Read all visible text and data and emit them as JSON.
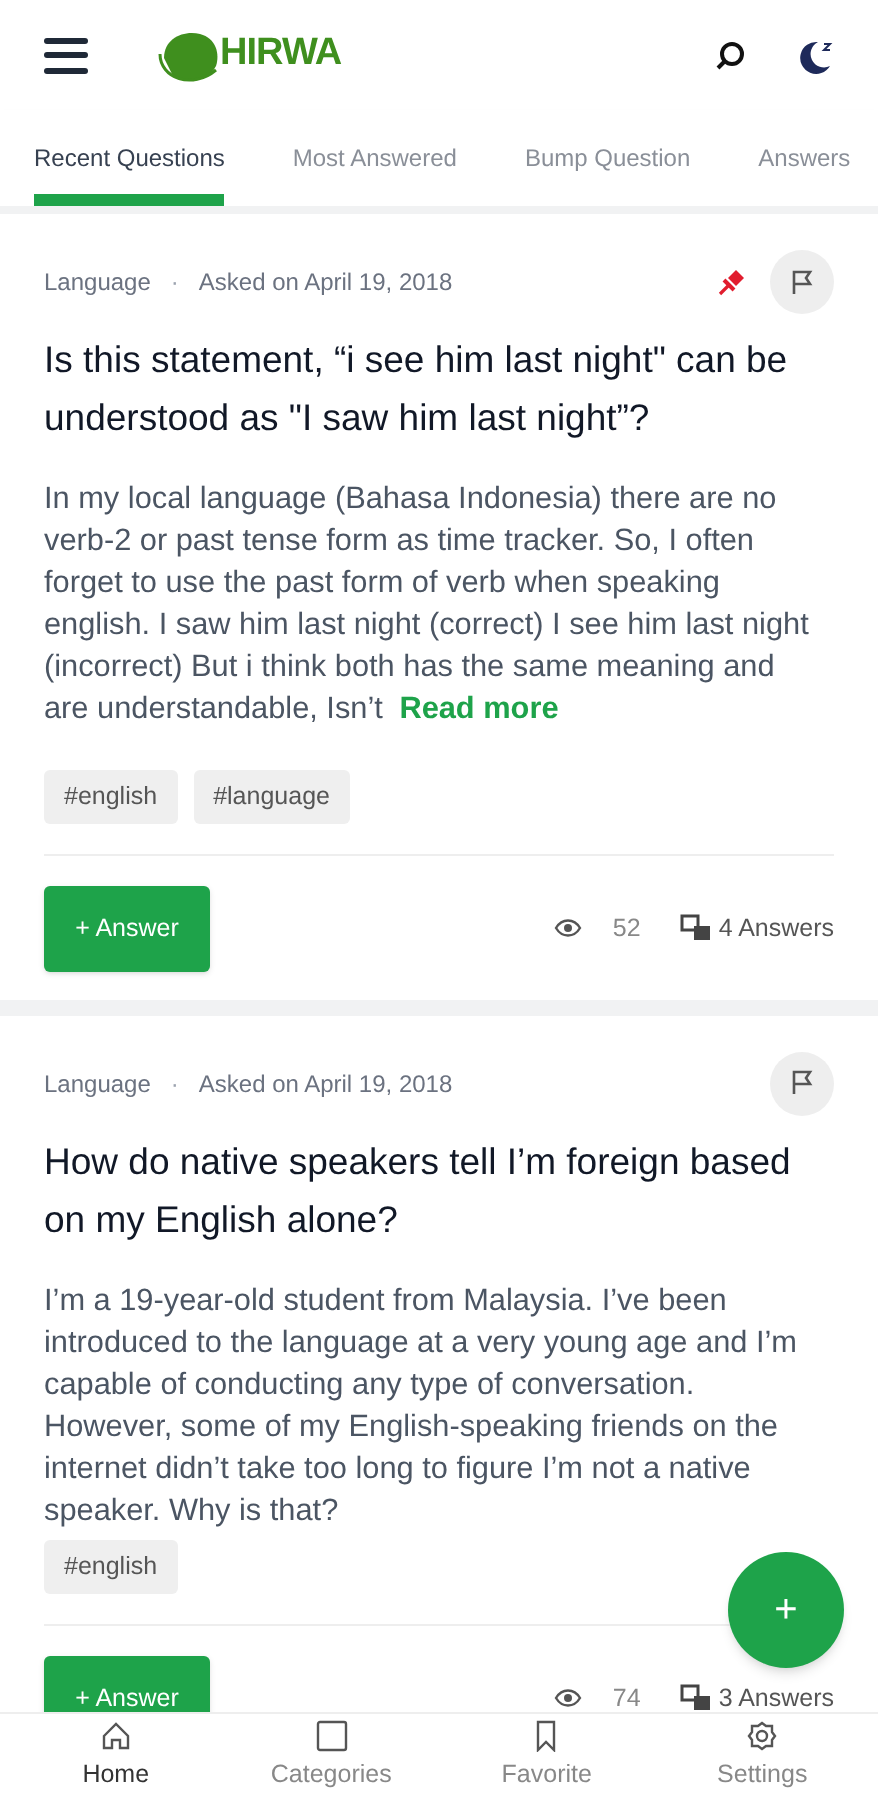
{
  "header": {
    "logo_text": "HIRWA"
  },
  "tabs": [
    {
      "label": "Recent Questions",
      "selected": true
    },
    {
      "label": "Most Answered",
      "selected": false
    },
    {
      "label": "Bump Question",
      "selected": false
    },
    {
      "label": "Answers",
      "selected": false
    }
  ],
  "questions": [
    {
      "category": "Language",
      "separator": "·",
      "asked": "Asked on April 19, 2018",
      "pinned": true,
      "title": "Is this statement, “i see him last night\" can be understood as \"I saw him last night”?",
      "body": "In my local language (Bahasa Indonesia) there are no verb-2 or past tense form as time tracker. So, I often forget to use the past form of verb when speaking english. I saw him last night (correct) I see him last night (incorrect) But i think both has the same meaning and are understandable, Isn’t",
      "read_more": "Read more",
      "tags": [
        "#english",
        "#language"
      ],
      "answer_button": "+ Answer",
      "views": "52",
      "answers": "4 Answers"
    },
    {
      "category": "Language",
      "separator": "·",
      "asked": "Asked on April 19, 2018",
      "pinned": false,
      "title": "How do native speakers tell I’m foreign based on my English alone?",
      "body": "I’m a 19-year-old student from Malaysia. I’ve been introduced to the language at a very young age and I’m capable of conducting any type of conversation. However, some of my English-speaking friends on the internet didn’t take too long to figure I’m not a native speaker. Why is that?",
      "tags": [
        "#english"
      ],
      "answer_button": "+ Answer",
      "views": "74",
      "answers": "3 Answers"
    }
  ],
  "fab": {
    "label": "+"
  },
  "bottom_nav": [
    {
      "label": "Home",
      "selected": true
    },
    {
      "label": "Categories",
      "selected": false
    },
    {
      "label": "Favorite",
      "selected": false
    },
    {
      "label": "Settings",
      "selected": false
    }
  ]
}
